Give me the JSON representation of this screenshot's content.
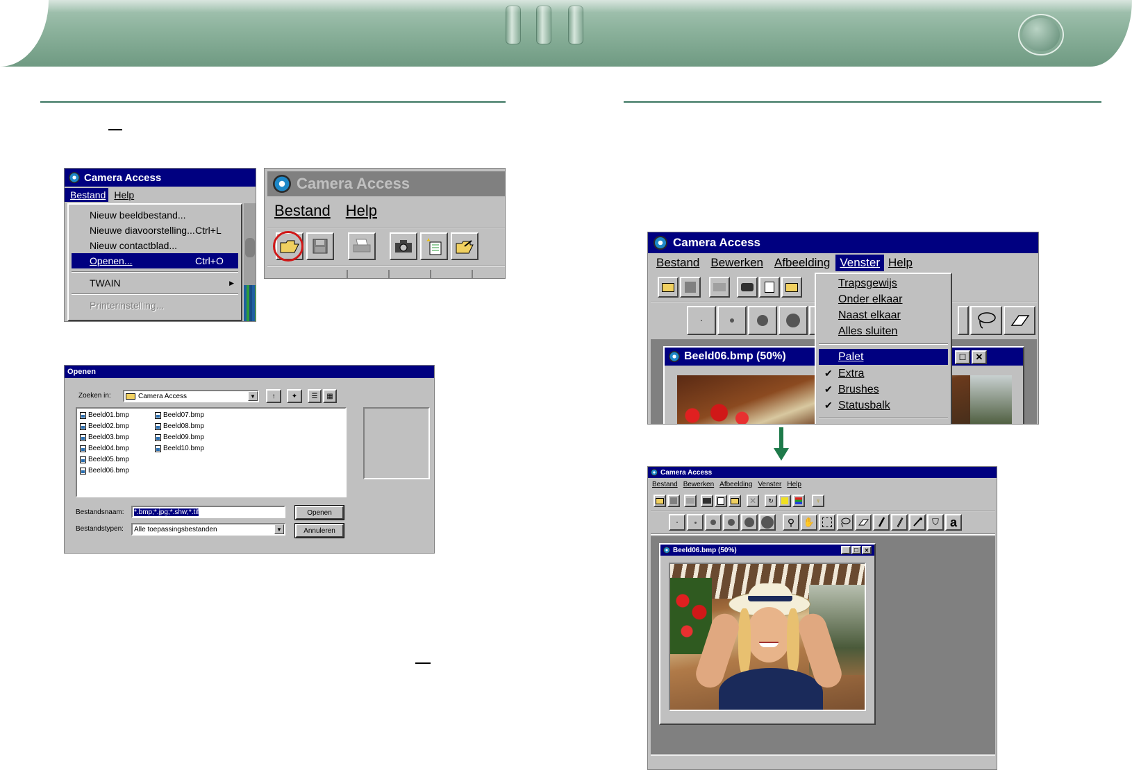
{
  "panelA": {
    "title": "Camera Access",
    "menu": [
      "Bestand",
      "Help"
    ],
    "items": [
      {
        "label": "Nieuw beeldbestand...",
        "accel": ""
      },
      {
        "label": "Nieuwe diavoorstelling...",
        "accel": "Ctrl+L"
      },
      {
        "label": "Nieuw contactblad...",
        "accel": ""
      },
      {
        "label": "Openen...",
        "accel": "Ctrl+O"
      },
      {
        "label": "TWAIN",
        "accel": ""
      },
      {
        "label": "Printerinstelling...",
        "accel": ""
      }
    ]
  },
  "panelB": {
    "title": "Camera Access",
    "menu": [
      "Bestand",
      "Help"
    ],
    "toolbar_icons": [
      "open-folder-icon",
      "save-icon",
      "print-icon",
      "camera-icon",
      "new-album-icon",
      "export-folder-icon"
    ]
  },
  "dialog": {
    "title": "Openen",
    "look_in_label": "Zoeken in:",
    "look_in_value": "Camera Access",
    "files": [
      "Beeld01.bmp",
      "Beeld02.bmp",
      "Beeld03.bmp",
      "Beeld04.bmp",
      "Beeld05.bmp",
      "Beeld06.bmp",
      "Beeld07.bmp",
      "Beeld08.bmp",
      "Beeld09.bmp",
      "Beeld10.bmp"
    ],
    "filename_label": "Bestandsnaam:",
    "filename_value": "*.bmp;*.jpg;*.shw;*.tif",
    "filetype_label": "Bestandstypen:",
    "filetype_value": "Alle toepassingsbestanden",
    "open_button": "Openen",
    "cancel_button": "Annuleren"
  },
  "panelC": {
    "title": "Camera Access",
    "menu": [
      "Bestand",
      "Bewerken",
      "Afbeelding",
      "Venster",
      "Help"
    ],
    "venster_items": [
      {
        "label": "Trapsgewijs",
        "checked": false
      },
      {
        "label": "Onder elkaar",
        "checked": false
      },
      {
        "label": "Naast elkaar",
        "checked": false
      },
      {
        "label": "Alles sluiten",
        "checked": false
      },
      {
        "label": "Palet",
        "checked": false
      },
      {
        "label": "Extra",
        "checked": true
      },
      {
        "label": "Brushes",
        "checked": true
      },
      {
        "label": "Statusbalk",
        "checked": true
      }
    ],
    "child_title": "Beeld06.bmp (50%)"
  },
  "panelD": {
    "title": "Camera Access",
    "menu": [
      "Bestand",
      "Bewerken",
      "Afbeelding",
      "Venster",
      "Help"
    ],
    "child_title": "Beeld06.bmp (50%)",
    "text_tool": "a"
  },
  "colors": {
    "accent_green": "#3a7560",
    "title_blue": "#000080",
    "arrow_green": "#1e7a4a"
  }
}
